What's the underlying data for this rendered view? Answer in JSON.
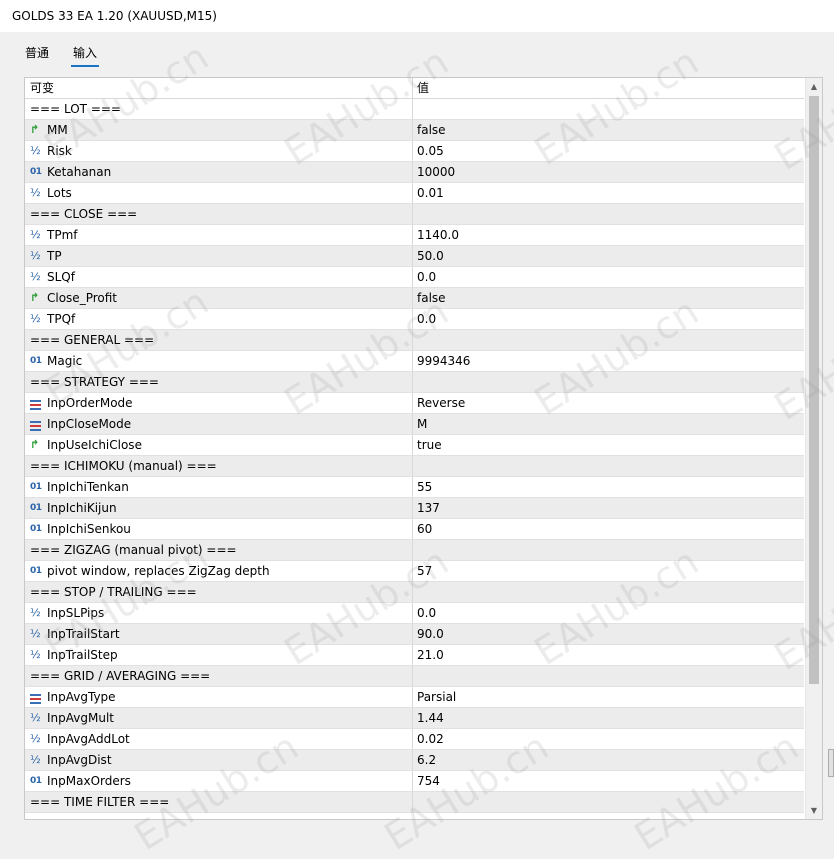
{
  "window": {
    "title": "GOLDS 33 EA 1.20 (XAUUSD,M15)"
  },
  "tabs": [
    {
      "label": "普通",
      "active": false
    },
    {
      "label": "输入",
      "active": true
    }
  ],
  "table": {
    "headers": {
      "variable": "可变",
      "value": "值"
    },
    "rows": [
      {
        "type": "section",
        "name": "=== LOT ===",
        "value": ""
      },
      {
        "type": "bool",
        "name": "MM",
        "value": "false"
      },
      {
        "type": "double",
        "name": "Risk",
        "value": "0.05"
      },
      {
        "type": "int",
        "name": "Ketahanan",
        "value": "10000"
      },
      {
        "type": "double",
        "name": "Lots",
        "value": "0.01"
      },
      {
        "type": "section",
        "name": "=== CLOSE ===",
        "value": ""
      },
      {
        "type": "double",
        "name": "TPmf",
        "value": "1140.0"
      },
      {
        "type": "double",
        "name": "TP",
        "value": "50.0"
      },
      {
        "type": "double",
        "name": "SLQf",
        "value": "0.0"
      },
      {
        "type": "bool",
        "name": "Close_Profit",
        "value": "false"
      },
      {
        "type": "double",
        "name": "TPQf",
        "value": "0.0"
      },
      {
        "type": "section",
        "name": "=== GENERAL ===",
        "value": ""
      },
      {
        "type": "int",
        "name": "Magic",
        "value": "9994346"
      },
      {
        "type": "section",
        "name": "=== STRATEGY ===",
        "value": ""
      },
      {
        "type": "enum",
        "name": "InpOrderMode",
        "value": "Reverse"
      },
      {
        "type": "enum",
        "name": "InpCloseMode",
        "value": "M"
      },
      {
        "type": "bool",
        "name": "InpUseIchiClose",
        "value": "true"
      },
      {
        "type": "section",
        "name": "=== ICHIMOKU (manual) ===",
        "value": ""
      },
      {
        "type": "int",
        "name": "InpIchiTenkan",
        "value": "55"
      },
      {
        "type": "int",
        "name": "InpIchiKijun",
        "value": "137"
      },
      {
        "type": "int",
        "name": "InpIchiSenkou",
        "value": "60"
      },
      {
        "type": "section",
        "name": "=== ZIGZAG (manual pivot) ===",
        "value": ""
      },
      {
        "type": "int",
        "name": "pivot window, replaces ZigZag depth",
        "value": "57"
      },
      {
        "type": "section",
        "name": "=== STOP / TRAILING ===",
        "value": ""
      },
      {
        "type": "double",
        "name": "InpSLPips",
        "value": "0.0"
      },
      {
        "type": "double",
        "name": "InpTrailStart",
        "value": "90.0"
      },
      {
        "type": "double",
        "name": "InpTrailStep",
        "value": "21.0"
      },
      {
        "type": "section",
        "name": "=== GRID / AVERAGING ===",
        "value": ""
      },
      {
        "type": "enum",
        "name": "InpAvgType",
        "value": "Parsial"
      },
      {
        "type": "double",
        "name": "InpAvgMult",
        "value": "1.44"
      },
      {
        "type": "double",
        "name": "InpAvgAddLot",
        "value": "0.02"
      },
      {
        "type": "double",
        "name": "InpAvgDist",
        "value": "6.2"
      },
      {
        "type": "int",
        "name": "InpMaxOrders",
        "value": "754"
      },
      {
        "type": "section",
        "name": "=== TIME FILTER ===",
        "value": ""
      }
    ]
  },
  "icons": {
    "bool": "bool-arrow-icon",
    "double": "fraction-half-icon",
    "int": "integer-01-icon",
    "enum": "enum-list-icon"
  },
  "watermark": "EAHub.cn"
}
